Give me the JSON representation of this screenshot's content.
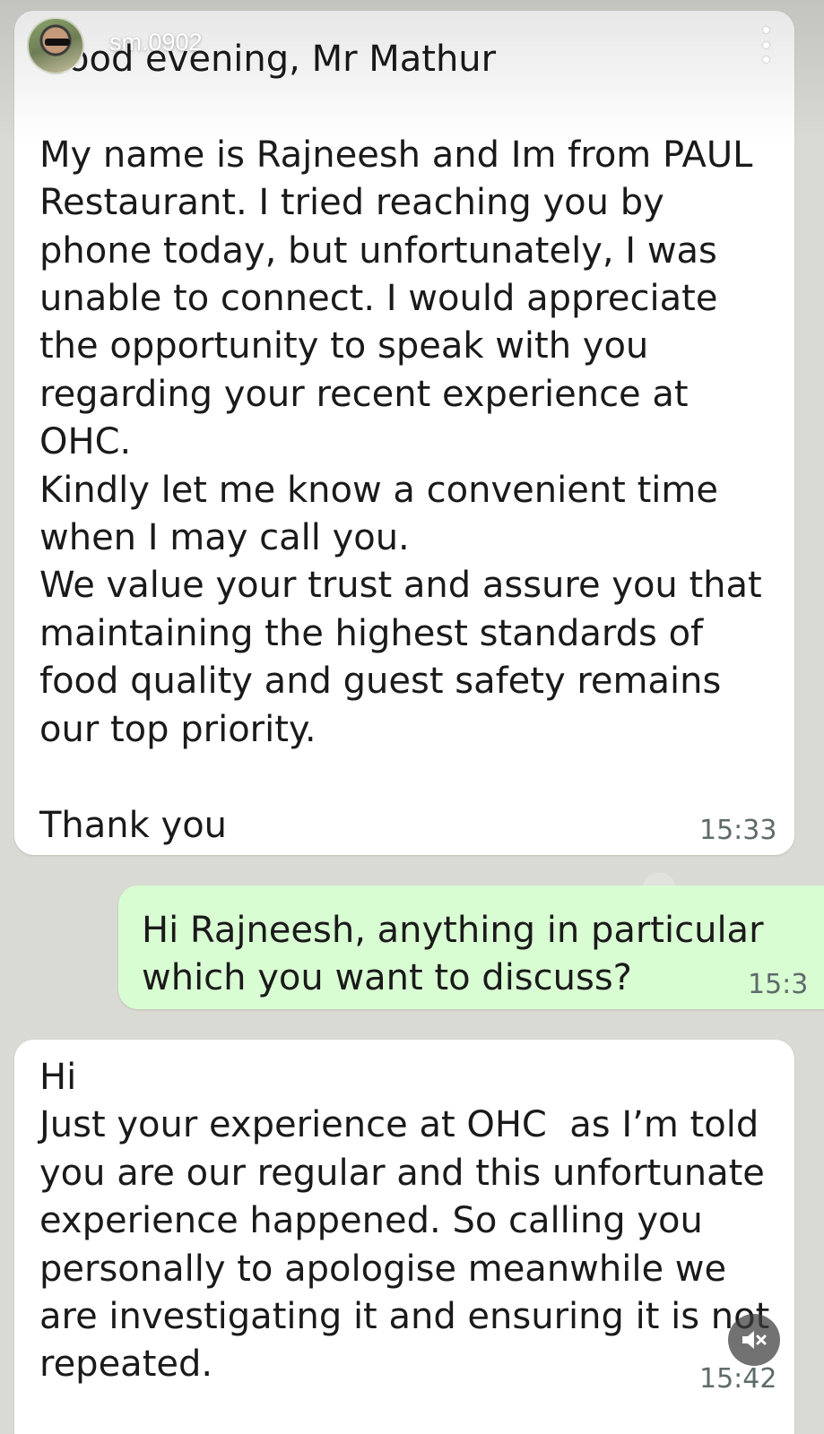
{
  "story_header": {
    "username": "sm.0902"
  },
  "messages": [
    {
      "direction": "incoming",
      "text": "Good evening, Mr Mathur\n\nMy name is Rajneesh and Im from PAUL Restaurant. I tried reaching you by phone today, but unfortunately, I was unable to connect. I would appreciate the opportunity to speak with you regarding your recent experience at OHC.\nKindly let me know a convenient time when I may call you.\nWe value your trust and assure you that maintaining the highest standards of food quality and guest safety remains our top priority.\n\nThank you",
      "time": "15:33"
    },
    {
      "direction": "outgoing",
      "text": "Hi Rajneesh, anything in particular which you want to discuss?",
      "time": "15:3"
    },
    {
      "direction": "incoming",
      "text": "Hi\nJust your experience at OHC  as I’m told you are our regular and this unfortunate experience happened. So calling you personally to apologise meanwhile we are investigating it and ensuring it is not repeated.",
      "time": "15:42"
    }
  ],
  "icons": {
    "menu": "more-vertical-icon",
    "mute": "speaker-muted-icon"
  },
  "colors": {
    "incoming_bubble": "#ffffff",
    "outgoing_bubble": "#d9fdd3",
    "timestamp": "#5f6b6b"
  }
}
